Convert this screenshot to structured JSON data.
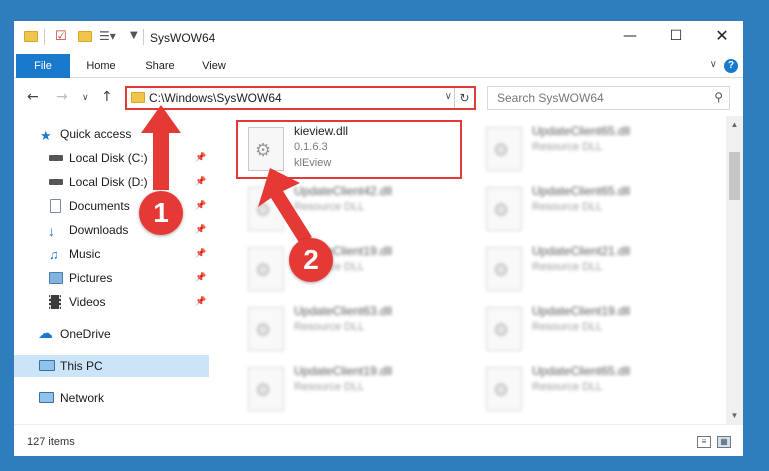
{
  "window": {
    "title": "SysWOW64"
  },
  "ribbon": {
    "tabs": [
      "File",
      "Home",
      "Share",
      "View"
    ],
    "help": "?"
  },
  "address": {
    "path": "C:\\Windows\\SysWOW64"
  },
  "search": {
    "placeholder": "Search SysWOW64"
  },
  "nav": {
    "items": [
      {
        "label": "Quick access",
        "icon": "star-icon",
        "pinned": false
      },
      {
        "label": "Local Disk (C:)",
        "icon": "drive-icon",
        "pinned": true
      },
      {
        "label": "Local Disk (D:)",
        "icon": "drive-icon",
        "pinned": true
      },
      {
        "label": "Documents",
        "icon": "documents-icon",
        "pinned": true
      },
      {
        "label": "Downloads",
        "icon": "downloads-icon",
        "pinned": true
      },
      {
        "label": "Music",
        "icon": "music-icon",
        "pinned": true
      },
      {
        "label": "Pictures",
        "icon": "pictures-icon",
        "pinned": true
      },
      {
        "label": "Videos",
        "icon": "videos-icon",
        "pinned": true
      },
      {
        "label": "OneDrive",
        "icon": "cloud-icon",
        "pinned": false
      },
      {
        "label": "This PC",
        "icon": "computer-icon",
        "pinned": false,
        "selected": true
      },
      {
        "label": "Network",
        "icon": "network-icon",
        "pinned": false
      }
    ]
  },
  "files": [
    {
      "name": "kieview.dll",
      "sub1": "0.1.6.3",
      "sub2": "klEview",
      "highlighted": true
    },
    {
      "name": "UpdateClient65.dll",
      "sub1": "Resource DLL"
    },
    {
      "name": "UpdateClient42.dll",
      "sub1": "Resource DLL"
    },
    {
      "name": "UpdateClient65.dll",
      "sub1": "Resource DLL"
    },
    {
      "name": "UpdateClient19.dll",
      "sub1": "Resource DLL"
    },
    {
      "name": "UpdateClient21.dll",
      "sub1": "Resource DLL"
    },
    {
      "name": "UpdateClient63.dll",
      "sub1": "Resource DLL"
    },
    {
      "name": "UpdateClient19.dll",
      "sub1": "Resource DLL"
    },
    {
      "name": "UpdateClient19.dll",
      "sub1": "Resource DLL"
    },
    {
      "name": "UpdateClient65.dll",
      "sub1": "Resource DLL"
    }
  ],
  "status": {
    "count": "127 items"
  },
  "annotations": {
    "step1": "1",
    "step2": "2",
    "color": "#e53935"
  }
}
